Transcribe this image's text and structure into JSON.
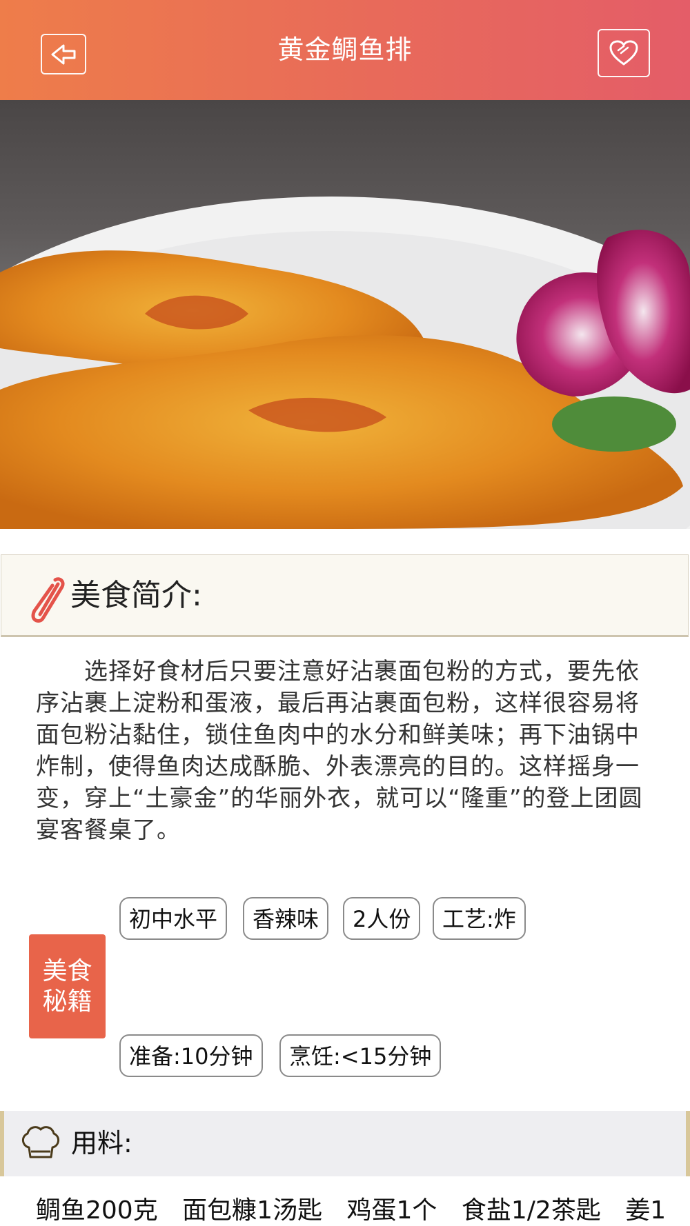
{
  "header": {
    "title": "黄金鲷鱼排",
    "back_icon": "back-arrow-icon",
    "fav_icon": "heart-icon"
  },
  "hero": {
    "alt": "黄金鲷鱼排"
  },
  "intro": {
    "heading": "美食简介:",
    "icon": "paperclip-icon",
    "text": "　　选择好食材后只要注意好沾裹面包粉的方式，要先依序沾裹上淀粉和蛋液，最后再沾裹面包粉，这样很容易将面包粉沾黏住，锁住鱼肉中的水分和鲜美味；再下油锅中炸制，使得鱼肉达成酥脆、外表漂亮的目的。这样摇身一变，穿上“土豪金”的华丽外衣，就可以“隆重”的登上团圆宴客餐桌了。"
  },
  "secrets": {
    "badge_line1": "美食",
    "badge_line2": "秘籍",
    "tags": [
      "初中水平",
      "香辣味",
      "2人份",
      "工艺:炸",
      "准备:10分钟",
      "烹饪:<15分钟"
    ]
  },
  "ingredients": {
    "heading": "用料:",
    "icon": "chef-hat-icon",
    "items": [
      "鲷鱼200克",
      "面包糠1汤匙",
      "鸡蛋1个",
      "食盐1/2茶匙",
      "姜1"
    ]
  },
  "colors": {
    "header_start": "#ee7d4a",
    "header_end": "#e45d68",
    "badge": "#e8644a"
  }
}
